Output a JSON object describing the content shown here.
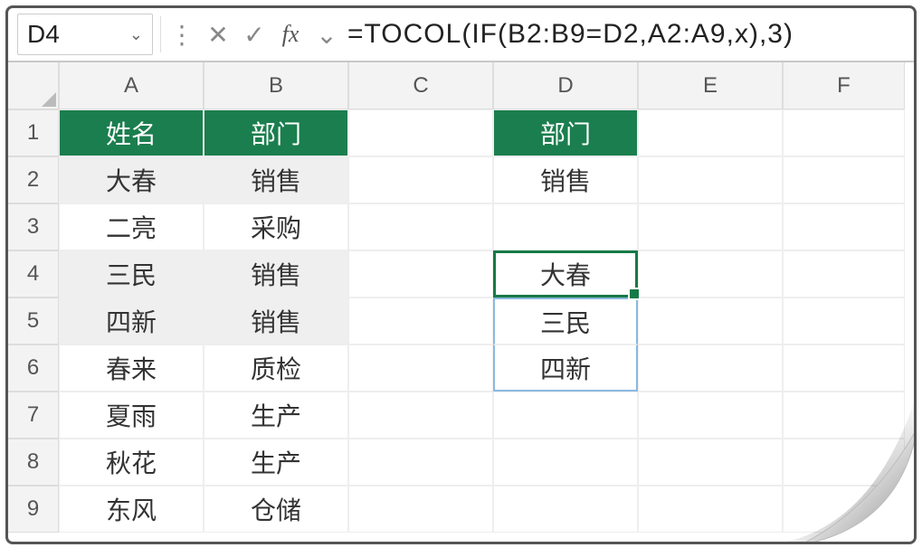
{
  "formula_bar": {
    "cell_ref": "D4",
    "formula": "=TOCOL(IF(B2:B9=D2,A2:A9,x),3)"
  },
  "columns": [
    "A",
    "B",
    "C",
    "D",
    "E",
    "F"
  ],
  "rows": [
    "1",
    "2",
    "3",
    "4",
    "5",
    "6",
    "7",
    "8",
    "9"
  ],
  "table_ab": {
    "header_a": "姓名",
    "header_b": "部门",
    "data": [
      {
        "a": "大春",
        "b": "销售"
      },
      {
        "a": "二亮",
        "b": "采购"
      },
      {
        "a": "三民",
        "b": "销售"
      },
      {
        "a": "四新",
        "b": "销售"
      },
      {
        "a": "春来",
        "b": "质检"
      },
      {
        "a": "夏雨",
        "b": "生产"
      },
      {
        "a": "秋花",
        "b": "生产"
      },
      {
        "a": "东风",
        "b": "仓储"
      }
    ]
  },
  "col_d": {
    "header": "部门",
    "filter_value": "销售",
    "results": [
      "大春",
      "三民",
      "四新"
    ]
  },
  "chart_data": {
    "type": "table",
    "title": "spreadsheet",
    "columns": [
      "",
      "A",
      "B",
      "C",
      "D",
      "E",
      "F"
    ],
    "rows": [
      [
        "1",
        "姓名",
        "部门",
        "",
        "部门",
        "",
        ""
      ],
      [
        "2",
        "大春",
        "销售",
        "",
        "销售",
        "",
        ""
      ],
      [
        "3",
        "二亮",
        "采购",
        "",
        "",
        "",
        ""
      ],
      [
        "4",
        "三民",
        "销售",
        "",
        "大春",
        "",
        ""
      ],
      [
        "5",
        "四新",
        "销售",
        "",
        "三民",
        "",
        ""
      ],
      [
        "6",
        "春来",
        "质检",
        "",
        "四新",
        "",
        ""
      ],
      [
        "7",
        "夏雨",
        "生产",
        "",
        "",
        "",
        ""
      ],
      [
        "8",
        "秋花",
        "生产",
        "",
        "",
        "",
        ""
      ],
      [
        "9",
        "东风",
        "仓储",
        "",
        "",
        "",
        ""
      ]
    ],
    "active_cell": "D4",
    "formula": "=TOCOL(IF(B2:B9=D2,A2:A9,x),3)"
  },
  "icons": {
    "chevron": "⌄",
    "colon": "⋮",
    "cancel": "✕",
    "accept": "✓",
    "fx": "fx"
  }
}
